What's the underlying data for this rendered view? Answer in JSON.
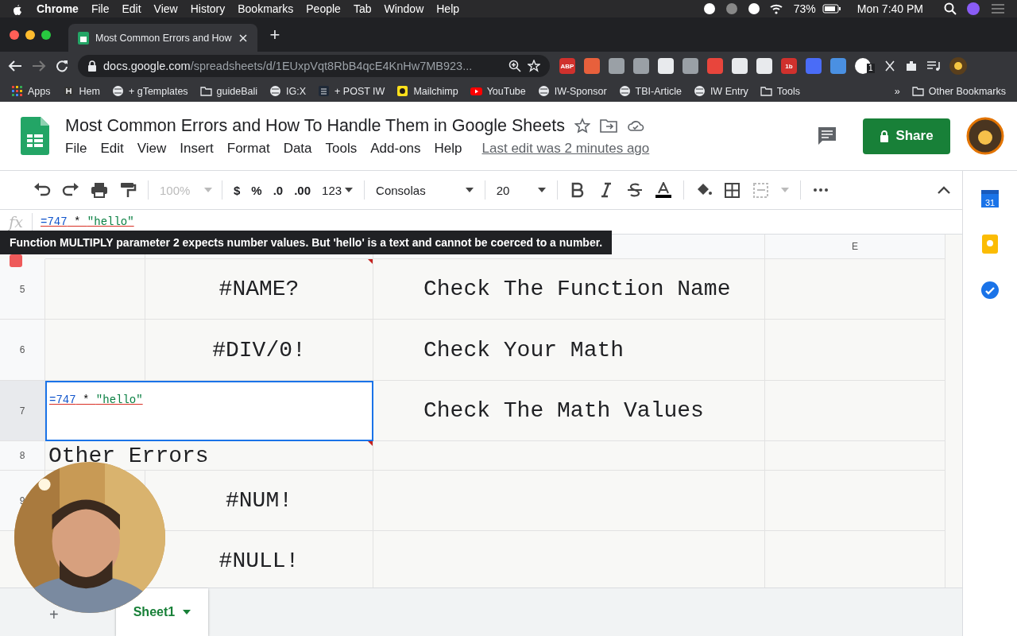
{
  "mac_menubar": {
    "app": "Chrome",
    "menus": [
      "File",
      "Edit",
      "View",
      "History",
      "Bookmarks",
      "People",
      "Tab",
      "Window",
      "Help"
    ],
    "battery": "73%",
    "clock": "Mon 7:40 PM"
  },
  "browser": {
    "tab": {
      "title": "Most Common Errors and How",
      "selected": true
    },
    "new_tab": "+",
    "url_host": "docs.google.com",
    "url_path": "/spreadsheets/d/1EUxpVqt8RbB4qcE4KnHw7MB923...",
    "extensions": [
      {
        "label": "ABP",
        "color": "#d0312d"
      },
      {
        "color": "#e8603c"
      },
      {
        "color": "#9aa0a6"
      },
      {
        "color": "#9aa0a6"
      },
      {
        "color": "#e8eaed"
      },
      {
        "color": "#9aa0a6"
      },
      {
        "color": "#e8453c"
      },
      {
        "color": "#e8eaed"
      },
      {
        "color": "#e8eaed"
      },
      {
        "label": "1b",
        "color": "#d0312d"
      },
      {
        "color": "#4a6cf7"
      },
      {
        "color": "#4a90e2"
      },
      {
        "color": "#ffffff",
        "badge": "1"
      }
    ],
    "bookmarks": [
      {
        "kind": "apps",
        "label": "Apps"
      },
      {
        "kind": "letter",
        "label": "Hem"
      },
      {
        "kind": "globe",
        "label": "+ gTemplates"
      },
      {
        "kind": "folder",
        "label": "guideBali"
      },
      {
        "kind": "globe",
        "label": "IG:X"
      },
      {
        "kind": "square",
        "label": "+ POST IW"
      },
      {
        "kind": "mail",
        "label": "Mailchimp"
      },
      {
        "kind": "video",
        "label": "YouTube"
      },
      {
        "kind": "globe",
        "label": "IW-Sponsor"
      },
      {
        "kind": "globe",
        "label": "TBI-Article"
      },
      {
        "kind": "globe",
        "label": "IW Entry"
      },
      {
        "kind": "folder",
        "label": "Tools"
      }
    ],
    "more": "»",
    "other": "Other Bookmarks"
  },
  "doc": {
    "title": "Most Common Errors and How To Handle Them in Google Sheets",
    "menus": [
      "File",
      "Edit",
      "View",
      "Insert",
      "Format",
      "Data",
      "Tools",
      "Add-ons",
      "Help"
    ],
    "last_edit": "Last edit was 2 minutes ago",
    "share": "Share"
  },
  "toolbar": {
    "zoom": "100%",
    "currency": "$",
    "percent": "%",
    "decrease_decimals": ".0",
    "increase_decimals": ".00",
    "number_format": "123",
    "font": "Consolas",
    "font_size": "20"
  },
  "formula_bar": {
    "label": "fx",
    "tokens": [
      {
        "kind": "number",
        "text": "=747"
      },
      {
        "kind": "operator",
        "text": " * "
      },
      {
        "kind": "string",
        "text": "\"hello\""
      }
    ]
  },
  "tooltip": "Function MULTIPLY parameter 2 expects number values. But 'hello' is a text and cannot be coerced to a number.",
  "columns": [
    "E"
  ],
  "rows": [
    {
      "number": "5",
      "selected": false,
      "error": "#NAME?",
      "hint": "Check The Function Name",
      "comment": true
    },
    {
      "number": "6",
      "selected": false,
      "error": "#DIV/0!",
      "hint": "Check Your Math",
      "comment": false
    },
    {
      "number": "7",
      "selected": true,
      "editing": [
        {
          "kind": "number",
          "text": "=747"
        },
        {
          "kind": "operator",
          "text": " * "
        },
        {
          "kind": "string",
          "text": "\"hello\""
        }
      ],
      "hint": "Check The Math Values",
      "comment": false
    },
    {
      "number": "8",
      "selected": false,
      "label": "Other Errors",
      "comment": true
    },
    {
      "number": "9",
      "selected": false,
      "error": "#NUM!",
      "comment": false
    },
    {
      "number": "",
      "selected": false,
      "error": "#NULL!",
      "comment": false
    }
  ],
  "sheet_tabs": {
    "add": "+",
    "tabs": [
      {
        "label": "Sheet1",
        "selected": true
      }
    ]
  },
  "side_panel": {
    "calendar_day": "31"
  }
}
